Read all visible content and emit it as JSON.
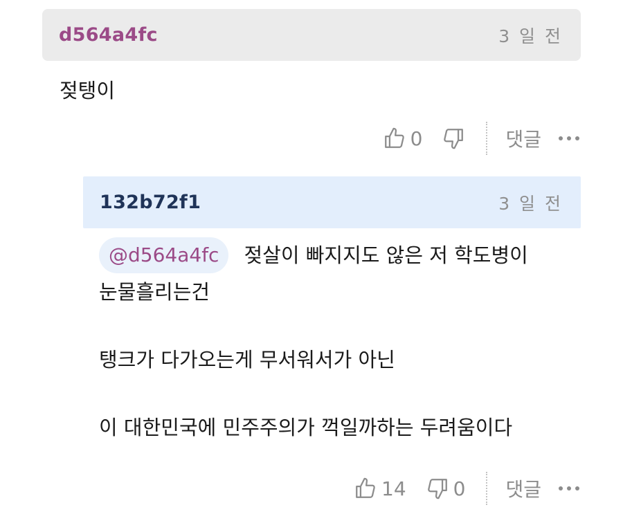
{
  "comment": {
    "author": "d564a4fc",
    "time": "3 일 전",
    "text": "젖탱이",
    "likes": "0",
    "reply_label": "댓글"
  },
  "reply": {
    "author": "132b72f1",
    "time": "3 일 전",
    "mention": "@d564a4fc",
    "line1": "젖살이 빠지지도 않은 저 학도병이",
    "line2": "눈물흘리는건",
    "line3": "탱크가 다가오는게 무서워서가 아닌",
    "line4": "이 대한민국에 민주주의가 꺽일까하는 두려움이다",
    "likes": "14",
    "dislikes": "0",
    "reply_label": "댓글"
  },
  "colors": {
    "author_comment": "#9b4a87",
    "author_reply": "#1f3358",
    "header_comment_bg": "#ebebeb",
    "header_reply_bg": "#e3eefc",
    "mention_bg": "#e9f1fb",
    "muted": "#8c8c8c"
  },
  "icons": {
    "like": "thumbs-up-outline",
    "dislike": "thumbs-down-outline",
    "more": "three-dots-horizontal"
  }
}
